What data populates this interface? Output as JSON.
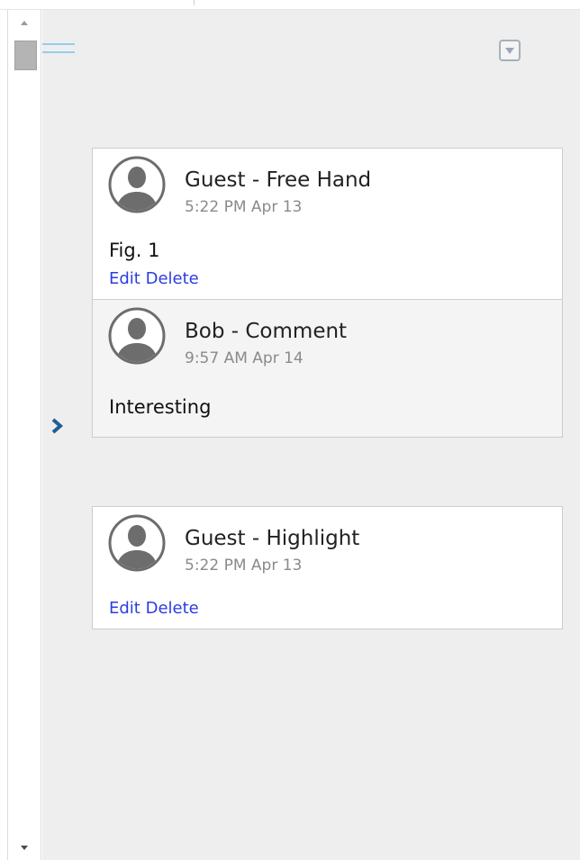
{
  "comments": [
    {
      "author": "Guest - Free Hand",
      "time": "5:22 PM Apr 13",
      "text": "Fig. 1",
      "edit_label": "Edit",
      "delete_label": "Delete"
    },
    {
      "author": "Bob - Comment",
      "time": "9:57 AM Apr 14",
      "text": "Interesting"
    },
    {
      "author": "Guest - Highlight",
      "time": "5:22 PM Apr 13",
      "edit_label": "Edit",
      "delete_label": "Delete"
    }
  ],
  "icons": {
    "menu": "menu-icon",
    "dropdown": "dropdown-icon",
    "expand": "chevron-right-icon",
    "avatar": "user-avatar-icon"
  },
  "colors": {
    "panel_bg": "#eeeeee",
    "link": "#2b3de0",
    "chevron": "#1f5f94",
    "menu_lines": "#8fd0ec"
  }
}
